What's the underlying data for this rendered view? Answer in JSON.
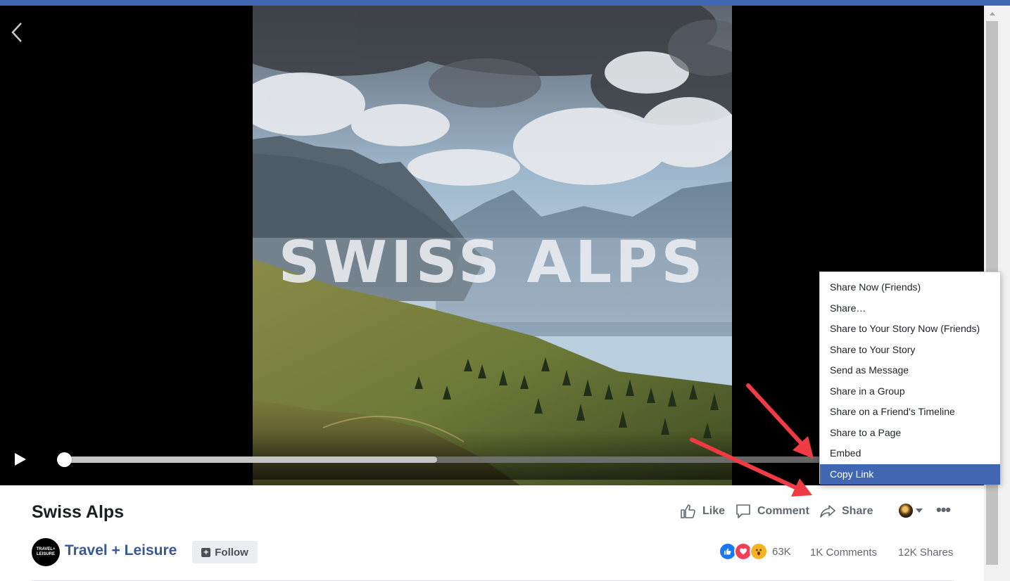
{
  "video": {
    "overlay_title": "SWISS ALPS",
    "progress_buffered": 0.49,
    "progress_played": 0.0
  },
  "post": {
    "title": "Swiss Alps",
    "page_name": "Travel + Leisure",
    "page_logo_text": "TRAVEL+ LEISURE",
    "follow_label": "Follow"
  },
  "actions": {
    "like_label": "Like",
    "comment_label": "Comment",
    "share_label": "Share"
  },
  "stats": {
    "reactions_count": "63K",
    "comments": "1K Comments",
    "shares": "12K Shares"
  },
  "share_menu": {
    "items": [
      "Share Now (Friends)",
      "Share…",
      "Share to Your Story Now (Friends)",
      "Share to Your Story",
      "Send as Message",
      "Share in a Group",
      "Share on a Friend's Timeline",
      "Share to a Page",
      "Embed",
      "Copy Link"
    ],
    "highlighted": "Copy Link"
  },
  "colors": {
    "facebook_blue": "#4267b2",
    "link_blue": "#385898",
    "annotation_red": "#ee3b44"
  }
}
